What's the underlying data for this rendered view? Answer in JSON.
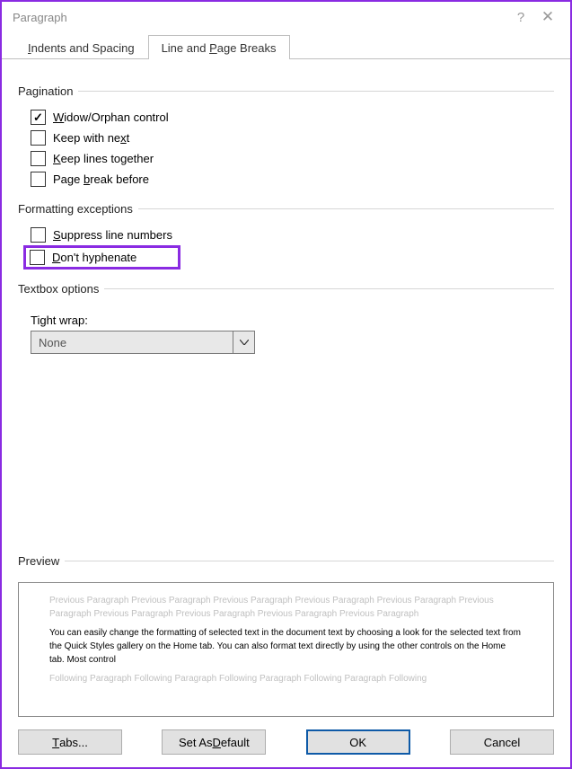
{
  "dialog": {
    "title": "Paragraph"
  },
  "tabs": {
    "indents_pre": "",
    "indents_ul": "I",
    "indents_post": "ndents and Spacing",
    "breaks_pre": "Line and ",
    "breaks_ul": "P",
    "breaks_post": "age Breaks"
  },
  "pagination": {
    "header": "Pagination",
    "widow_pre": "",
    "widow_ul": "W",
    "widow_post": "idow/Orphan control",
    "keepnext_pre": "Keep with ne",
    "keepnext_ul": "x",
    "keepnext_post": "t",
    "keeplines_pre": "",
    "keeplines_ul": "K",
    "keeplines_post": "eep lines together",
    "pagebreak_pre": "Page ",
    "pagebreak_ul": "b",
    "pagebreak_post": "reak before"
  },
  "formatting": {
    "header": "Formatting exceptions",
    "suppress_pre": "",
    "suppress_ul": "S",
    "suppress_post": "uppress line numbers",
    "hyphen_pre": "",
    "hyphen_ul": "D",
    "hyphen_post": "on't hyphenate"
  },
  "textbox": {
    "header": "Textbox options",
    "tight_label": "Tight wrap:",
    "value": "None"
  },
  "preview": {
    "header": "Preview",
    "ghost_before": "Previous Paragraph Previous Paragraph Previous Paragraph Previous Paragraph Previous Paragraph Previous Paragraph Previous Paragraph Previous Paragraph Previous Paragraph Previous Paragraph",
    "main": "You can easily change the formatting of selected text in the document text by choosing a look for the selected text from the Quick Styles gallery on the Home tab. You can also format text directly by using the other controls on the Home tab. Most control",
    "ghost_after": "Following Paragraph Following Paragraph Following Paragraph Following Paragraph Following"
  },
  "buttons": {
    "tabs_pre": "",
    "tabs_ul": "T",
    "tabs_post": "abs...",
    "default_pre": "Set As ",
    "default_ul": "D",
    "default_post": "efault",
    "ok": "OK",
    "cancel": "Cancel"
  }
}
